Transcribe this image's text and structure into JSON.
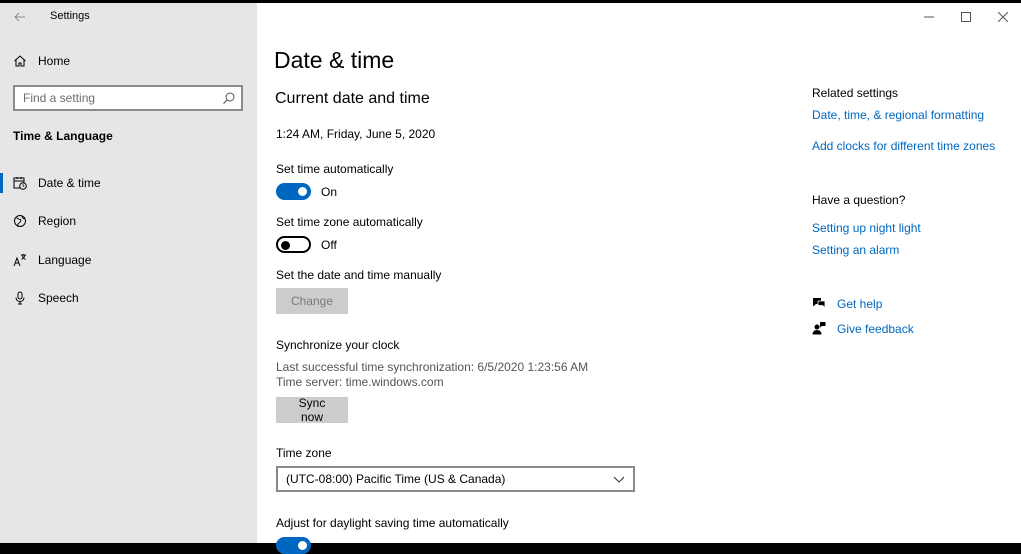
{
  "window": {
    "app_title": "Settings"
  },
  "sidebar": {
    "home": {
      "label": "Home",
      "icon": "home-icon"
    },
    "search": {
      "placeholder": "Find a setting",
      "icon": "search-icon"
    },
    "section_title": "Time & Language",
    "items": [
      {
        "label": "Date & time",
        "icon": "calendar-clock-icon",
        "active": true
      },
      {
        "label": "Region",
        "icon": "globe-icon",
        "active": false
      },
      {
        "label": "Language",
        "icon": "language-icon",
        "active": false
      },
      {
        "label": "Speech",
        "icon": "microphone-icon",
        "active": false
      }
    ]
  },
  "main": {
    "title": "Date & time",
    "current_heading": "Current date and time",
    "current_value": "1:24 AM, Friday, June 5, 2020",
    "set_time_auto": {
      "label": "Set time automatically",
      "state": "On",
      "on": true
    },
    "set_zone_auto": {
      "label": "Set time zone automatically",
      "state": "Off",
      "on": false
    },
    "manual": {
      "label": "Set the date and time manually",
      "button": "Change"
    },
    "sync": {
      "heading": "Synchronize your clock",
      "last_sync": "Last successful time synchronization: 6/5/2020 1:23:56 AM",
      "server": "Time server: time.windows.com",
      "button": "Sync now"
    },
    "time_zone": {
      "label": "Time zone",
      "value": "(UTC-08:00) Pacific Time (US & Canada)"
    },
    "daylight": {
      "label": "Adjust for daylight saving time automatically",
      "on": true
    }
  },
  "related": {
    "heading": "Related settings",
    "links": [
      "Date, time, & regional formatting",
      "Add clocks for different time zones"
    ],
    "question_heading": "Have a question?",
    "question_links": [
      "Setting up night light",
      "Setting an alarm"
    ],
    "get_help": "Get help",
    "give_feedback": "Give feedback"
  },
  "colors": {
    "accent": "#0067c0",
    "sidebar_bg": "#e6e6e6",
    "button_bg": "#cccccc"
  }
}
